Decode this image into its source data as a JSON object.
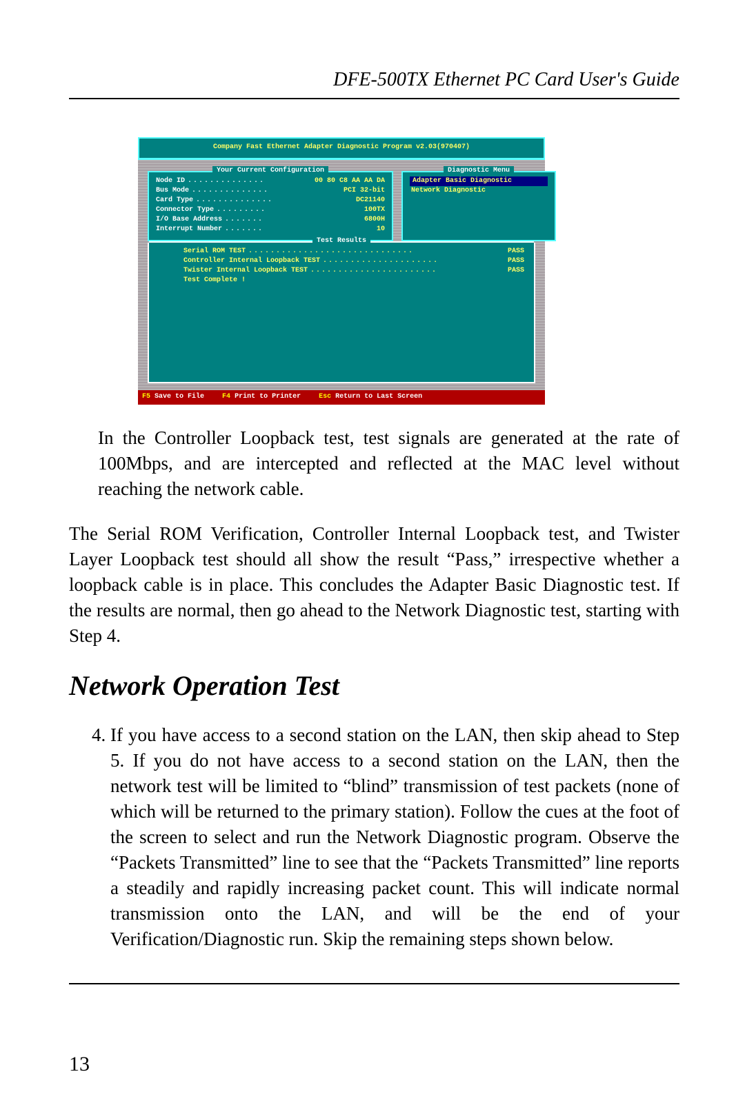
{
  "header": {
    "running_head": "DFE-500TX Ethernet PC Card User's Guide"
  },
  "screenshot": {
    "title": "Company Fast Ethernet Adapter Diagnostic Program v2.03(970407)",
    "config_box_title": "Your Current Configuration",
    "config": [
      {
        "label": "Node ID",
        "value": "00 80 C8 AA AA DA"
      },
      {
        "label": "Bus Mode",
        "value": "PCI 32-bit"
      },
      {
        "label": "Card Type",
        "value": "DC21140"
      },
      {
        "label": "Connector Type",
        "value": "100TX"
      },
      {
        "label": "I/O Base Address",
        "value": "6800H"
      },
      {
        "label": "Interrupt Number",
        "value": "10"
      }
    ],
    "menu_box_title": "Diagnostic Menu",
    "menu_items": [
      {
        "label": "Adapter Basic Diagnostic",
        "selected": true
      },
      {
        "label": "Network Diagnostic",
        "selected": false
      }
    ],
    "results_box_title": "Test Results",
    "results": [
      {
        "name": "Serial ROM TEST",
        "status": "PASS"
      },
      {
        "name": "Controller Internal Loopback TEST",
        "status": "PASS"
      },
      {
        "name": "Twister Internal Loopback TEST",
        "status": "PASS"
      }
    ],
    "results_complete": "Test Complete !",
    "status_bar": [
      {
        "key": "F5",
        "label": "Save to File"
      },
      {
        "key": "F4",
        "label": "Print to Printer"
      },
      {
        "key": "Esc",
        "label": "Return to Last Screen"
      }
    ]
  },
  "body": {
    "para1": "In the Controller Loopback test, test signals are generated at the rate of 100Mbps, and are intercepted and reflected at the MAC level without reaching the network cable.",
    "para2": "The Serial ROM Verification, Controller Internal Loopback test, and Twister Layer Loopback test should all show the result “Pass,” irrespective whether a loopback cable is in place.  This concludes the Adapter Basic Diagnostic test.  If the results are normal, then go ahead to the Network Diagnostic test, starting with Step 4.",
    "h2": "Network Operation Test",
    "step4": "If you have access to a second station on the LAN, then skip ahead to Step 5.  If you do not have access to a second station on the LAN, then the network test will be limited to “blind” transmission of test packets (none of which will be returned to the primary station).  Follow the cues at the foot of the screen to select and run the Network Diagnostic program.  Observe the “Packets Transmitted” line to see that the “Packets Transmitted” line reports a steadily and rapidly increasing packet count.  This will indicate normal transmission onto the LAN, and will be the end of your Verification/Diagnostic run.  Skip the remaining steps shown below."
  },
  "page_number": "13"
}
